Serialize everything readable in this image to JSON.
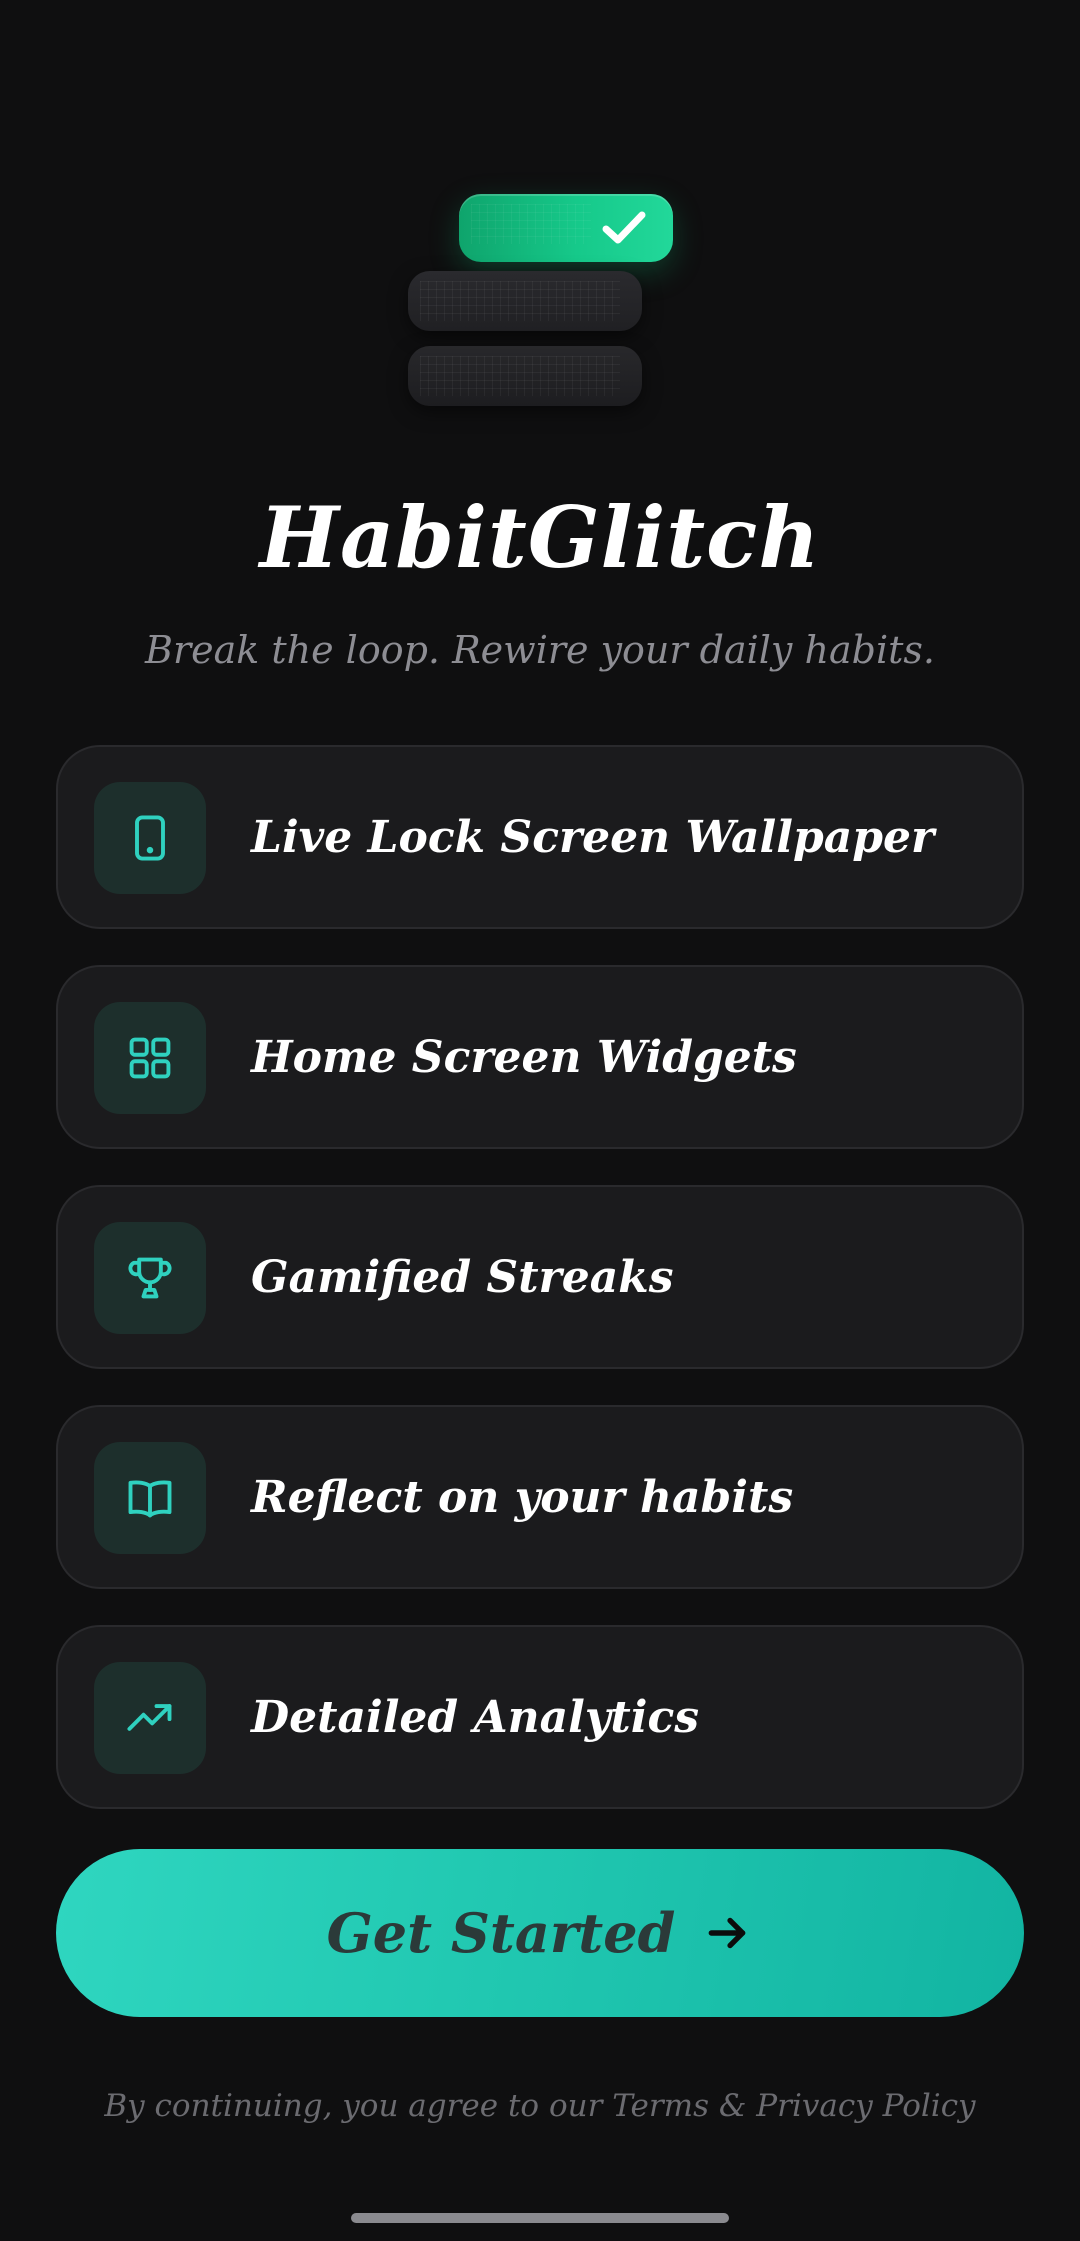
{
  "app": {
    "title": "HabitGlitch",
    "tagline": "Break the loop. Rewire your daily habits."
  },
  "logo": {
    "name": "app-logo",
    "icons": [
      "check-icon"
    ]
  },
  "features": [
    {
      "label": "Live Lock Screen Wallpaper",
      "icon": "phone-icon"
    },
    {
      "label": "Home Screen Widgets",
      "icon": "grid-icon"
    },
    {
      "label": "Gamified Streaks",
      "icon": "trophy-icon"
    },
    {
      "label": "Reflect on your habits",
      "icon": "book-icon"
    },
    {
      "label": "Detailed Analytics",
      "icon": "trending-up-icon"
    }
  ],
  "cta": {
    "label": "Get Started",
    "icon": "arrow-right-icon"
  },
  "legal": {
    "text": "By continuing, you agree to our Terms & Privacy Policy"
  },
  "colors": {
    "background": "#0f0f10",
    "card": "#1b1b1d",
    "accent": "#2fd1bf",
    "logo_green": "#16c98a",
    "icon_tile": "#1d2f2c",
    "muted_text": "#8d8d93"
  }
}
